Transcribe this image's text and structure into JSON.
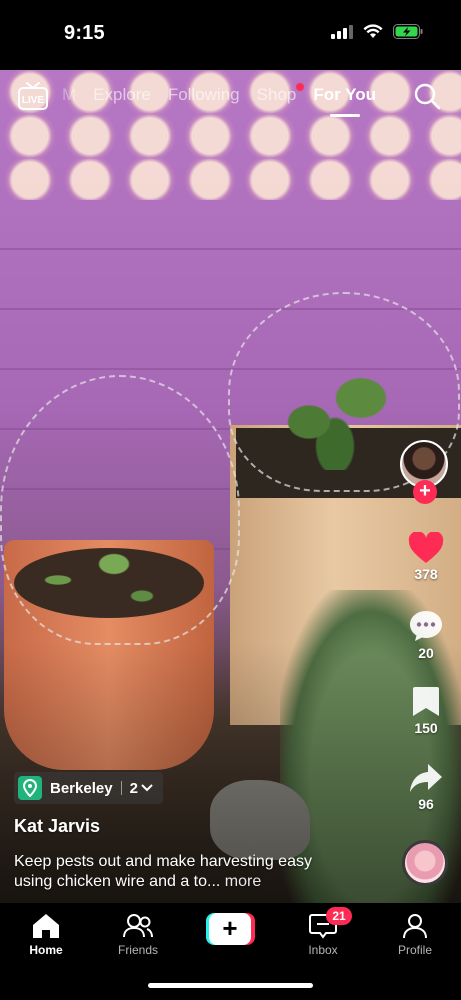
{
  "status_bar": {
    "time": "9:15",
    "icons": [
      "cellular-signal-icon",
      "wifi-icon",
      "battery-charging-icon"
    ],
    "battery_color": "#32d74b"
  },
  "top_nav": {
    "live_label": "LIVE",
    "tabs": [
      {
        "label": "M",
        "state": "faint"
      },
      {
        "label": "Explore",
        "state": "inactive"
      },
      {
        "label": "Following",
        "state": "inactive"
      },
      {
        "label": "Shop",
        "state": "inactive",
        "has_dot": true
      },
      {
        "label": "For You",
        "state": "active"
      }
    ],
    "search_icon": "search-icon"
  },
  "right_rail": {
    "avatar": "creator-avatar",
    "follow_icon": "plus-icon",
    "likes": "378",
    "comments": "20",
    "saves": "150",
    "shares": "96",
    "like_color": "#fe2c55"
  },
  "caption": {
    "location": "Berkeley",
    "location_count": "2",
    "username": "Kat Jarvis",
    "text": "Keep pests out and make harvesting easy using chicken wire and a to...",
    "more_label": " more"
  },
  "tabbar": {
    "tabs": [
      {
        "label": "Home",
        "icon": "home-icon",
        "active": true
      },
      {
        "label": "Friends",
        "icon": "friends-icon",
        "active": false
      },
      {
        "label": "",
        "icon": "create-plus-icon",
        "active": false
      },
      {
        "label": "Inbox",
        "icon": "inbox-icon",
        "active": false
      },
      {
        "label": "Profile",
        "icon": "profile-icon",
        "active": false
      }
    ],
    "inbox_badge": "21",
    "accent_red": "#fe2c55",
    "accent_cyan": "#25f4ee"
  }
}
